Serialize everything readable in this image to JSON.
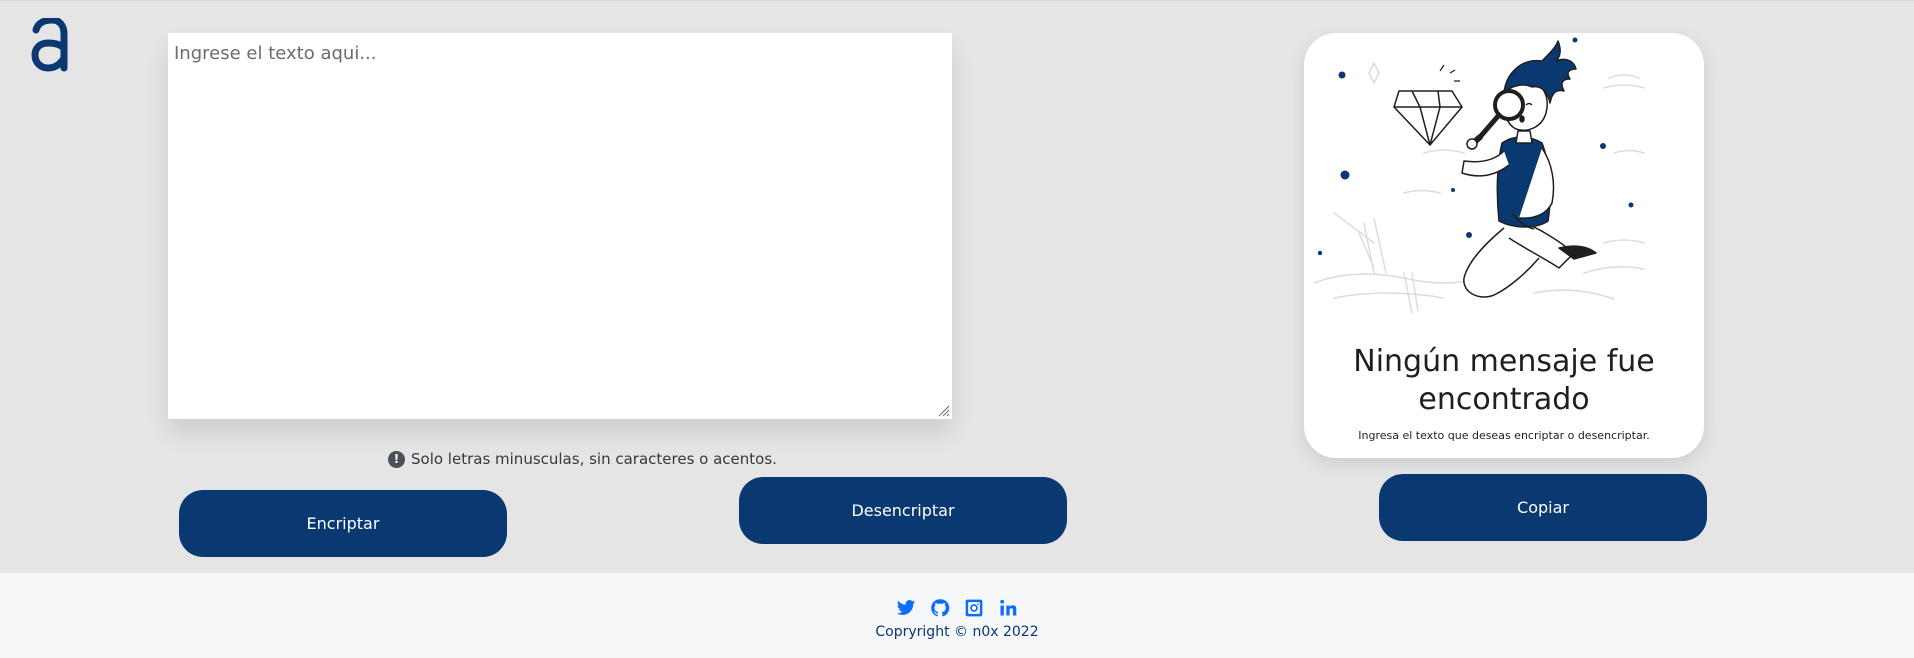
{
  "input": {
    "placeholder": "Ingrese el texto aqui...",
    "value": ""
  },
  "hint": {
    "icon": "info-icon",
    "icon_glyph": "!",
    "text": "Solo letras minusculas, sin caracteres o acentos."
  },
  "buttons": {
    "encrypt_label": "Encriptar",
    "decrypt_label": "Desencriptar",
    "copy_label": "Copiar"
  },
  "output_card": {
    "title": "Ningún mensaje fue encontrado",
    "subtitle": "Ingresa el texto que deseas encriptar o desencriptar.",
    "illustration": "person-with-magnifying-glass-and-diamond"
  },
  "footer": {
    "social_icons": [
      "twitter-icon",
      "github-icon",
      "instagram-icon",
      "linkedin-icon"
    ],
    "copyright": "Copryright © n0x 2022"
  },
  "colors": {
    "background": "#e5e5e5",
    "primary": "#0a3871",
    "button_text": "#ffffff",
    "footer_background": "#f6f7f8",
    "social_icon": "#0d6efd"
  }
}
